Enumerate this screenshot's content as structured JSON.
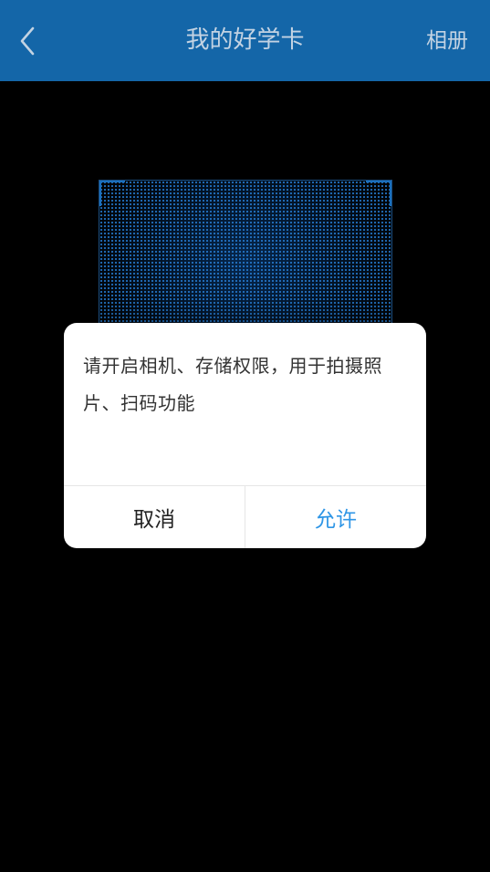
{
  "header": {
    "title": "我的好学卡",
    "back_icon": "chevron-left-icon",
    "album_label": "相册",
    "background_color": "#1466a8",
    "text_color": "#c3d3e3"
  },
  "scanner": {
    "frame_color": "#1a6fbd"
  },
  "dialog": {
    "message": "请开启相机、存储权限，用于拍摄照片、扫码功能",
    "cancel_label": "取消",
    "allow_label": "允许",
    "allow_color": "#2f96e6"
  }
}
